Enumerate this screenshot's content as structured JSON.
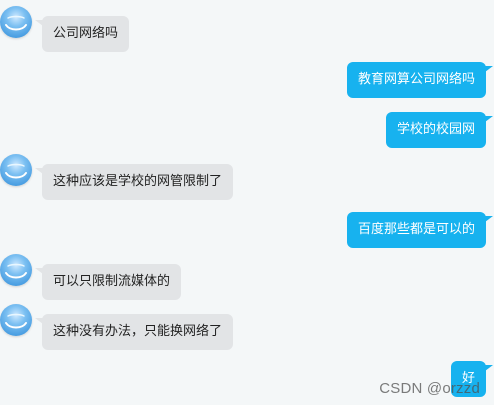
{
  "messages": [
    {
      "side": "left",
      "text": "公司网络吗"
    },
    {
      "side": "right",
      "text": "教育网算公司网络吗"
    },
    {
      "side": "right",
      "text": "学校的校园网"
    },
    {
      "side": "left",
      "text": "这种应该是学校的网管限制了"
    },
    {
      "side": "right",
      "text": "百度那些都是可以的"
    },
    {
      "side": "left",
      "text": "可以只限制流媒体的"
    },
    {
      "side": "left",
      "text": "这种没有办法，只能换网络了"
    },
    {
      "side": "right",
      "text": "好"
    }
  ],
  "watermark": "CSDN @orzzd",
  "colors": {
    "background": "#f4f7f8",
    "incoming_bubble": "#e2e4e6",
    "outgoing_bubble": "#17b2ef"
  },
  "icons": {
    "avatar": "whale-avatar-icon"
  }
}
